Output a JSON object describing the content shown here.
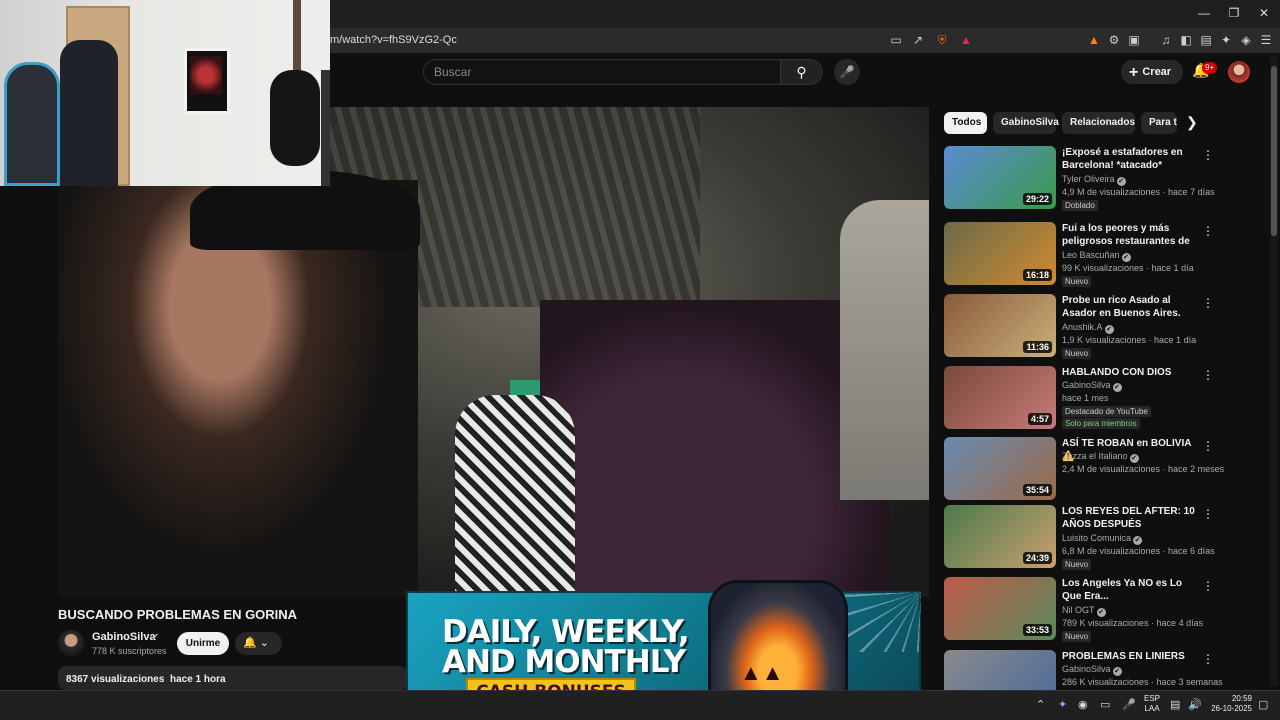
{
  "browser": {
    "url": "m/watch?v=fhS9VzG2-Qc",
    "window_controls": [
      "minimize",
      "maximize",
      "close"
    ]
  },
  "youtube": {
    "search_placeholder": "Buscar",
    "create_label": "Crear",
    "notif_count": "9+"
  },
  "video": {
    "title": "BUSCANDO PROBLEMAS EN GORINA",
    "channel": "GabinoSilva",
    "subscribers": "778 K suscriptores",
    "unsubscribe_label": "Unirme",
    "views": "8367 visualizaciones",
    "age": "hace 1 hora"
  },
  "ad": {
    "line1": "DAILY, WEEKLY,",
    "line2": "AND MONTHLY",
    "line3": "CASH BONUSES"
  },
  "chips": [
    "Todos",
    "GabinoSilva",
    "Relacionados",
    "Para ti"
  ],
  "recommendations": [
    {
      "title": "¡Exposé a estafadores en Barcelona! *atacado*",
      "channel": "Tyler Oliveira",
      "meta": "4,9 M de visualizaciones · hace 7 días",
      "badge": "Doblado",
      "badge2": "",
      "duration": "29:22",
      "colors": [
        "#5b8bd6",
        "#3a9a4a"
      ]
    },
    {
      "title": "Fui a los peores y más peligrosos restaurantes de mi ...",
      "channel": "Leo Bascuñan",
      "meta": "99 K visualizaciones · hace 1 día",
      "badge": "Nuevo",
      "badge2": "",
      "duration": "16:18",
      "colors": [
        "#6b6b4a",
        "#d08a30"
      ]
    },
    {
      "title": "Probe un rico Asado al Asador en Buenos Aires. Vlog",
      "channel": "Anushik.A",
      "meta": "1,9 K visualizaciones · hace 1 día",
      "badge": "Nuevo",
      "badge2": "",
      "duration": "11:36",
      "colors": [
        "#8a5a3a",
        "#c9b07a"
      ]
    },
    {
      "title": "HABLANDO CON DIOS",
      "channel": "GabinoSilva",
      "meta": "hace 1 mes",
      "badge": "Destacado de YouTube",
      "badge2": "Solo para miembros",
      "duration": "4:57",
      "colors": [
        "#7a4a3a",
        "#c77a7a"
      ]
    },
    {
      "title": "ASÍ TE ROBAN en BOLIVIA ⚠️",
      "channel": "Zazza el Italiano",
      "meta": "2,4 M de visualizaciones · hace 2 meses",
      "badge": "",
      "badge2": "",
      "duration": "35:54",
      "colors": [
        "#6a8ab0",
        "#9a6a4a"
      ]
    },
    {
      "title": "LOS REYES DEL AFTER: 10 AÑOS DESPUÉS",
      "channel": "Luisito Comunica",
      "meta": "6,8 M de visualizaciones · hace 6 días",
      "badge": "Nuevo",
      "badge2": "",
      "duration": "24:39",
      "colors": [
        "#4a7a4a",
        "#c9a070"
      ]
    },
    {
      "title": "Los Angeles Ya NO es Lo Que Era...",
      "channel": "Nil OGT",
      "meta": "789 K visualizaciones · hace 4 días",
      "badge": "Nuevo",
      "badge2": "",
      "duration": "33:53",
      "colors": [
        "#c05a4a",
        "#5a8a5a"
      ]
    },
    {
      "title": "PROBLEMAS EN LINIERS",
      "channel": "GabinoSilva",
      "meta": "286 K visualizaciones · hace 3 semanas",
      "badge": "",
      "badge2": "",
      "duration": "",
      "colors": [
        "#8a8a8a",
        "#4a6a9a"
      ]
    }
  ],
  "taskbar": {
    "lang1": "ESP",
    "lang2": "LAA",
    "time": "20:59",
    "date": "26-10-2025"
  }
}
